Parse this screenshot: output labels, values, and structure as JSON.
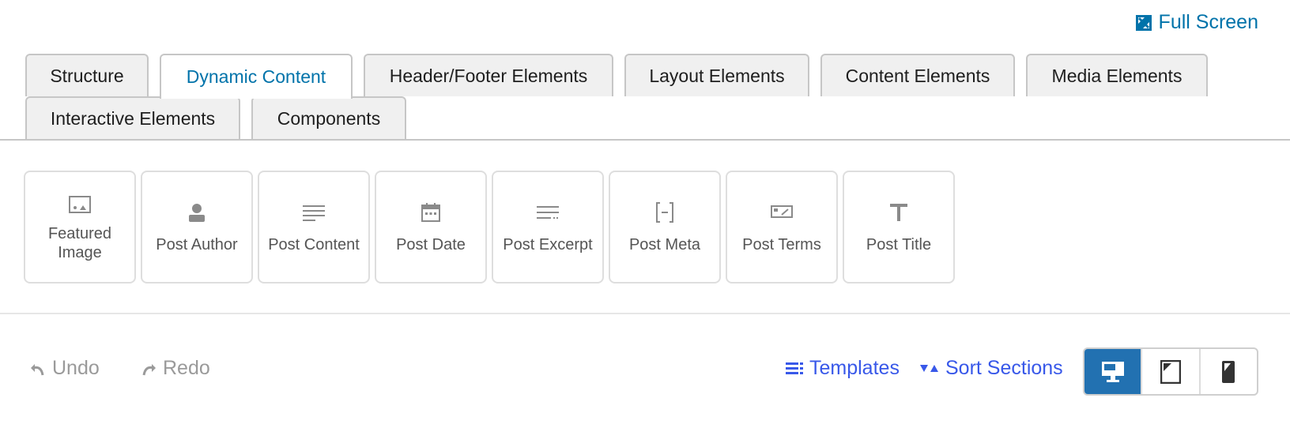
{
  "header": {
    "fullscreen_label": "Full Screen",
    "fullscreen_icon": "fullscreen-icon"
  },
  "tabs": [
    {
      "label": "Structure",
      "active": false
    },
    {
      "label": "Dynamic Content",
      "active": true
    },
    {
      "label": "Header/Footer Elements",
      "active": false
    },
    {
      "label": "Layout Elements",
      "active": false
    },
    {
      "label": "Content Elements",
      "active": false
    },
    {
      "label": "Media Elements",
      "active": false
    },
    {
      "label": "Interactive Elements",
      "active": false
    },
    {
      "label": "Components",
      "active": false
    }
  ],
  "blocks": [
    {
      "label": "Featured Image",
      "icon": "featured-image-icon"
    },
    {
      "label": "Post Author",
      "icon": "post-author-icon"
    },
    {
      "label": "Post Content",
      "icon": "post-content-icon"
    },
    {
      "label": "Post Date",
      "icon": "post-date-icon"
    },
    {
      "label": "Post Excerpt",
      "icon": "post-excerpt-icon"
    },
    {
      "label": "Post Meta",
      "icon": "post-meta-icon"
    },
    {
      "label": "Post Terms",
      "icon": "post-terms-icon"
    },
    {
      "label": "Post Title",
      "icon": "post-title-icon"
    }
  ],
  "toolbar": {
    "undo_label": "Undo",
    "redo_label": "Redo",
    "templates_label": "Templates",
    "sort_label": "Sort Sections",
    "devices": [
      {
        "name": "desktop",
        "active": true,
        "icon": "desktop-icon"
      },
      {
        "name": "tablet",
        "active": false,
        "icon": "tablet-icon"
      },
      {
        "name": "mobile",
        "active": false,
        "icon": "mobile-icon"
      }
    ]
  },
  "colors": {
    "link": "#0073aa",
    "accent": "#3858e9",
    "device_active": "#2271b1",
    "disabled": "#9a9a9a"
  }
}
